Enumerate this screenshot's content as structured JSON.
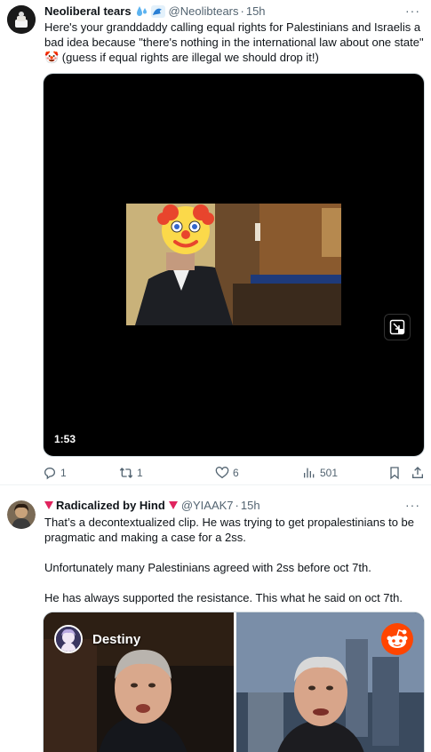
{
  "tweet1": {
    "name": "Neoliberal tears",
    "name_icons": [
      "droplets-icon",
      "wave-icon"
    ],
    "handle": "@Neolibtears",
    "time": "15h",
    "text": "Here's your granddaddy calling equal rights for Palestinians and Israelis a bad idea because \"there's nothing in the international law about one state\" 🤡 (guess if equal rights are illegal we should drop it!)",
    "video_duration": "1:53",
    "actions": {
      "replies": "1",
      "reposts": "1",
      "likes": "6",
      "views": "501"
    }
  },
  "tweet2": {
    "name": "Radicalized by Hind",
    "handle": "@YIAAK7",
    "time": "15h",
    "paragraphs": [
      "That’s a decontextualized clip.  He was trying to get propalestinians to be pragmatic and making a case for a 2ss.",
      "Unfortunately many Palestinians agreed with 2ss before oct 7th.",
      "He has always supported the resistance.  This what he said on oct 7th."
    ],
    "media_channel": "Destiny"
  },
  "colors": {
    "accent": "#1d9bf0",
    "muted": "#536471",
    "heart_red": "#e0245e"
  }
}
